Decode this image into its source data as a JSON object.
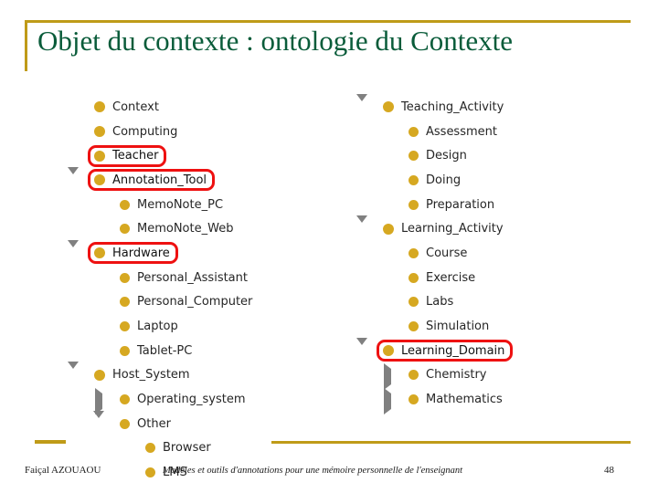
{
  "slide": {
    "title": "Objet du contexte : ontologie du Contexte",
    "accent_color": "#BF9B18",
    "title_color": "#0A5C3A",
    "bullet_color": "#D6A821",
    "highlight_color": "#EE1111"
  },
  "tree_left": [
    {
      "label": "Context",
      "indent": 1,
      "toggle": "none",
      "marked": false
    },
    {
      "label": "Computing",
      "indent": 1,
      "toggle": "none",
      "marked": false
    },
    {
      "label": "Teacher",
      "indent": 1,
      "toggle": "none",
      "marked": true
    },
    {
      "label": "Annotation_Tool",
      "indent": 1,
      "toggle": "collapse",
      "marked": true
    },
    {
      "label": "MemoNote_PC",
      "indent": 2,
      "toggle": "none",
      "marked": false
    },
    {
      "label": "MemoNote_Web",
      "indent": 2,
      "toggle": "none",
      "marked": false
    },
    {
      "label": "Hardware",
      "indent": 1,
      "toggle": "collapse",
      "marked": true
    },
    {
      "label": "Personal_Assistant",
      "indent": 2,
      "toggle": "none",
      "marked": false
    },
    {
      "label": "Personal_Computer",
      "indent": 2,
      "toggle": "none",
      "marked": false
    },
    {
      "label": "Laptop",
      "indent": 2,
      "toggle": "none",
      "marked": false
    },
    {
      "label": "Tablet-PC",
      "indent": 2,
      "toggle": "none",
      "marked": false
    },
    {
      "label": "Host_System",
      "indent": 1,
      "toggle": "collapse",
      "marked": false
    },
    {
      "label": "Operating_system",
      "indent": 2,
      "toggle": "expand",
      "marked": false
    },
    {
      "label": "Other",
      "indent": 2,
      "toggle": "collapse",
      "marked": false
    },
    {
      "label": "Browser",
      "indent": 3,
      "toggle": "none",
      "marked": false
    },
    {
      "label": "LMS",
      "indent": 3,
      "toggle": "none",
      "marked": false
    }
  ],
  "tree_right": [
    {
      "label": "Teaching_Activity",
      "indent": 1,
      "toggle": "collapse",
      "marked": false
    },
    {
      "label": "Assessment",
      "indent": 2,
      "toggle": "none",
      "marked": false
    },
    {
      "label": "Design",
      "indent": 2,
      "toggle": "none",
      "marked": false
    },
    {
      "label": "Doing",
      "indent": 2,
      "toggle": "none",
      "marked": false
    },
    {
      "label": "Preparation",
      "indent": 2,
      "toggle": "none",
      "marked": false
    },
    {
      "label": "Learning_Activity",
      "indent": 1,
      "toggle": "collapse",
      "marked": false
    },
    {
      "label": "Course",
      "indent": 2,
      "toggle": "none",
      "marked": false
    },
    {
      "label": "Exercise",
      "indent": 2,
      "toggle": "none",
      "marked": false
    },
    {
      "label": "Labs",
      "indent": 2,
      "toggle": "none",
      "marked": false
    },
    {
      "label": "Simulation",
      "indent": 2,
      "toggle": "none",
      "marked": false
    },
    {
      "label": "Learning_Domain",
      "indent": 1,
      "toggle": "collapse",
      "marked": true
    },
    {
      "label": "Chemistry",
      "indent": 2,
      "toggle": "expand",
      "marked": false
    },
    {
      "label": "Mathematics",
      "indent": 2,
      "toggle": "expand",
      "marked": false
    }
  ],
  "footer": {
    "author": "Faiçal AZOUAOU",
    "subject": "Modèles et outils d'annotations pour une mémoire personnelle de l'enseignant",
    "page": "48"
  }
}
